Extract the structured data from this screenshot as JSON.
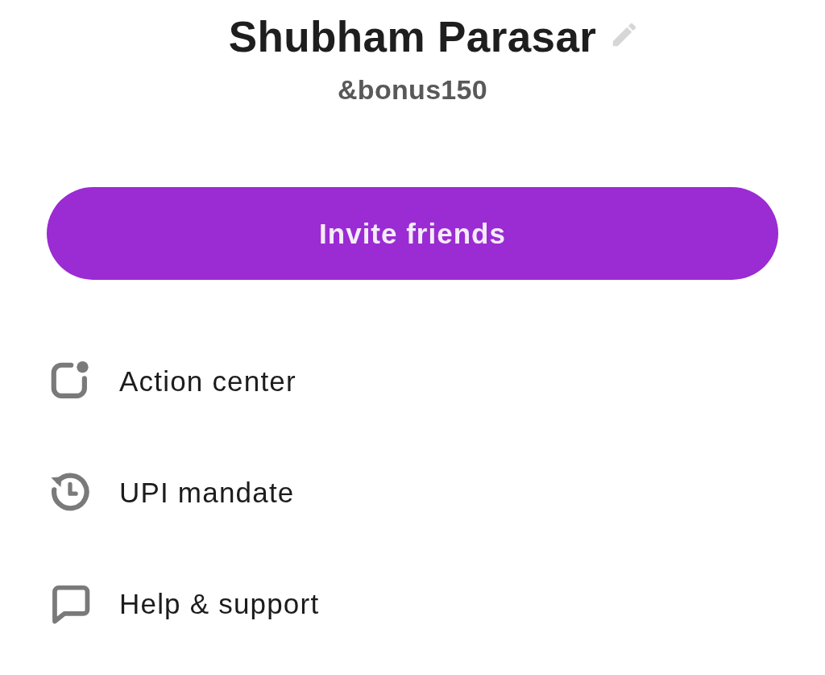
{
  "profile": {
    "name": "Shubham Parasar",
    "handle": "&bonus150"
  },
  "invite_button": {
    "label": "Invite friends"
  },
  "menu": [
    {
      "label": "Action center"
    },
    {
      "label": "UPI mandate"
    },
    {
      "label": "Help & support"
    }
  ]
}
